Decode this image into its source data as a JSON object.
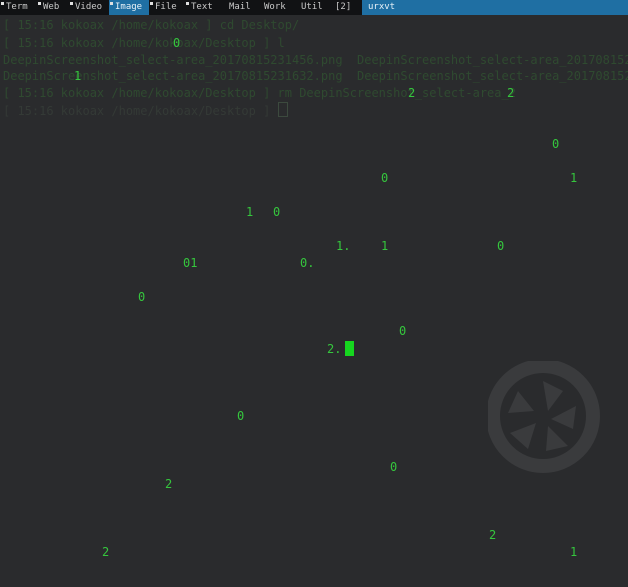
{
  "tags": [
    {
      "label": "Term",
      "selected": false
    },
    {
      "label": "Web",
      "selected": false
    },
    {
      "label": "Video",
      "selected": false
    },
    {
      "label": "Image",
      "selected": true
    },
    {
      "label": "File",
      "selected": false
    },
    {
      "label": "Text",
      "selected": false
    },
    {
      "label": "Mail",
      "selected": false
    },
    {
      "label": "Work",
      "selected": false
    },
    {
      "label": "Util",
      "selected": false
    },
    {
      "label": "[2]",
      "selected": false
    }
  ],
  "window_title": "urxvt",
  "terminal": {
    "lines": [
      "[ 15:16 kokoax /home/kokoax ] cd Desktop/",
      "[ 15:16 kokoax /home/kokoax/Desktop ] l",
      "DeepinScreenshot_select-area_20170815231456.png  DeepinScreenshot_select-area_20170815231632.png",
      "DeepinScreenshot_select-area_20170815231632.png  DeepinScreenshot_select-area_20170815231645.png",
      "[ 15:16 kokoax /home/kokoax/Desktop ] rm DeepinScreenshot_select-area_2",
      "[ 15:16 kokoax /home/kokoax/Desktop ] "
    ],
    "digits": [
      "0",
      "1",
      "2",
      "2",
      "0",
      "0",
      "1",
      "1",
      "0",
      "1.",
      "1",
      "0",
      "01",
      "0.",
      "0",
      "0",
      "2.",
      "0",
      "0",
      "2",
      "2",
      "2",
      "1"
    ]
  },
  "colors": {
    "background": "#2a2b2d",
    "digit_green": "#35c63d",
    "selected_tag": "#1f6fa3"
  }
}
